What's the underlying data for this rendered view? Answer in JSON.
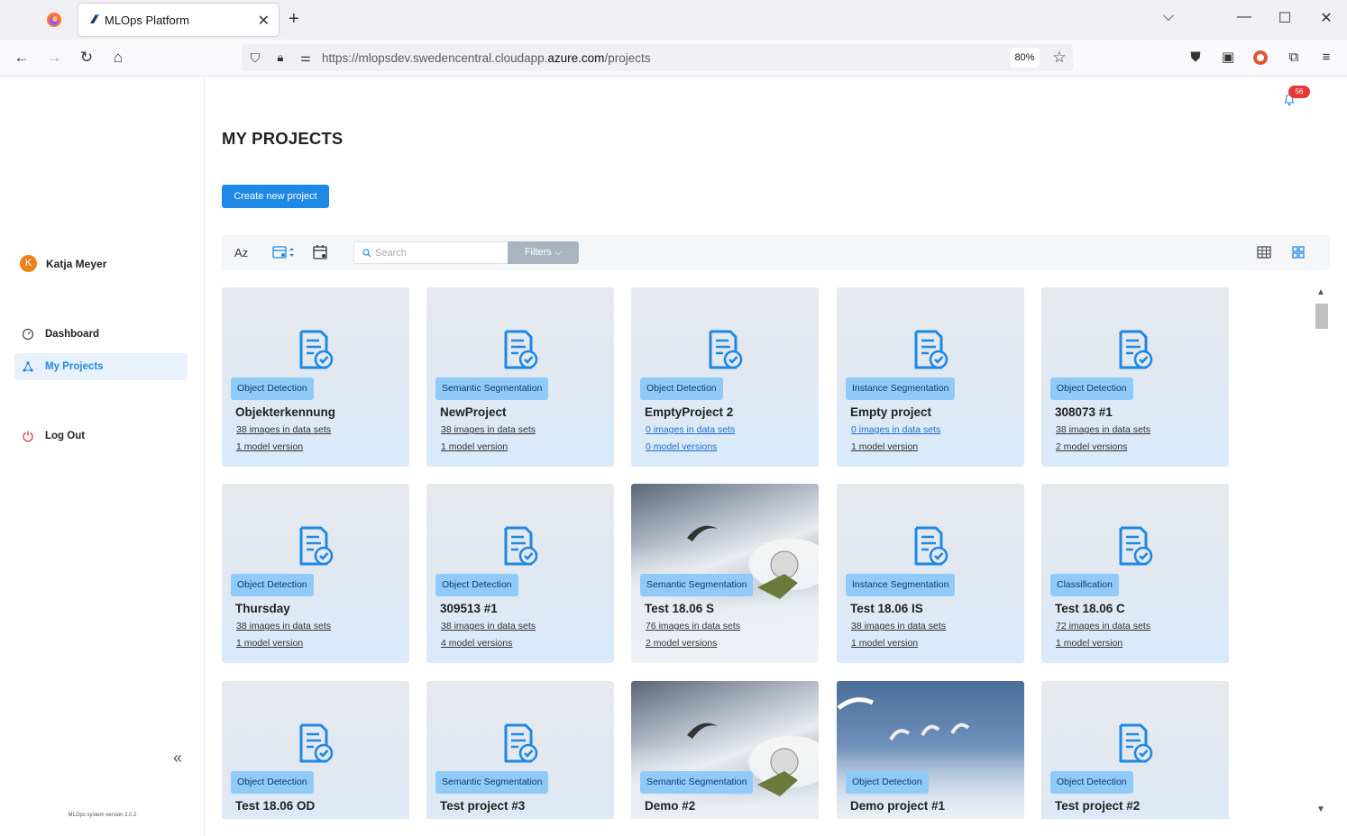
{
  "browser": {
    "tab_title": "MLOps Platform",
    "url_prefix": "https://mlopsdev.swedencentral.cloudapp.",
    "url_domain": "azure.com",
    "url_path": "/projects",
    "zoom": "80%"
  },
  "sidebar": {
    "user_initial": "K",
    "user_name": "Katja Meyer",
    "items": [
      {
        "label": "Dashboard"
      },
      {
        "label": "My Projects"
      }
    ],
    "logout_label": "Log Out",
    "version": "MLOps system version 2.0.2",
    "collapse_glyph": "«"
  },
  "header": {
    "notification_count": "56"
  },
  "page": {
    "title": "MY PROJECTS",
    "create_button": "Create new project"
  },
  "toolbar": {
    "sort_az": "Az",
    "search_placeholder": "Search",
    "filters_label": "Filters ⌵"
  },
  "projects": [
    {
      "type": "Object Detection",
      "name": "Objekterkennung",
      "images": "38 images in data sets",
      "models": "1 model version",
      "zero": false
    },
    {
      "type": "Semantic Segmentation",
      "name": "NewProject",
      "images": "38 images in data sets",
      "models": "1 model version",
      "zero": false
    },
    {
      "type": "Object Detection",
      "name": "EmptyProject 2",
      "images": "0 images in data sets",
      "models": "0 model versions",
      "zero": true
    },
    {
      "type": "Instance Segmentation",
      "name": "Empty project",
      "images": "0 images in data sets",
      "models": "1 model version",
      "zero": false
    },
    {
      "type": "Object Detection",
      "name": "308073 #1",
      "images": "38 images in data sets",
      "models": "2 model versions",
      "zero": false
    },
    {
      "type": "Object Detection",
      "name": "Thursday",
      "images": "38 images in data sets",
      "models": "1 model version",
      "zero": false
    },
    {
      "type": "Object Detection",
      "name": "309513 #1",
      "images": "38 images in data sets",
      "models": "4 model versions",
      "zero": false
    },
    {
      "type": "Semantic Segmentation",
      "name": "Test 18.06  S",
      "images": "76 images in data sets",
      "models": "2 model versions",
      "zero": false
    },
    {
      "type": "Instance Segmentation",
      "name": "Test 18.06 IS",
      "images": "38 images in data sets",
      "models": "1 model version",
      "zero": false
    },
    {
      "type": "Classification",
      "name": "Test 18.06 C",
      "images": "72 images in data sets",
      "models": "1 model version",
      "zero": false
    },
    {
      "type": "Object Detection",
      "name": "Test 18.06 OD",
      "images": "",
      "models": "",
      "zero": false
    },
    {
      "type": "Semantic Segmentation",
      "name": "Test project #3",
      "images": "",
      "models": "",
      "zero": false
    },
    {
      "type": "Semantic Segmentation",
      "name": "Demo #2",
      "images": "",
      "models": "",
      "zero": false
    },
    {
      "type": "Object Detection",
      "name": "Demo project #1",
      "images": "",
      "models": "",
      "zero": false
    },
    {
      "type": "Object Detection",
      "name": "Test project #2",
      "images": "",
      "models": "",
      "zero": false
    }
  ],
  "colors": {
    "accent": "#1e88e5",
    "badge_bg": "#90caf9",
    "notification": "#e53935",
    "avatar": "#e8841a"
  }
}
